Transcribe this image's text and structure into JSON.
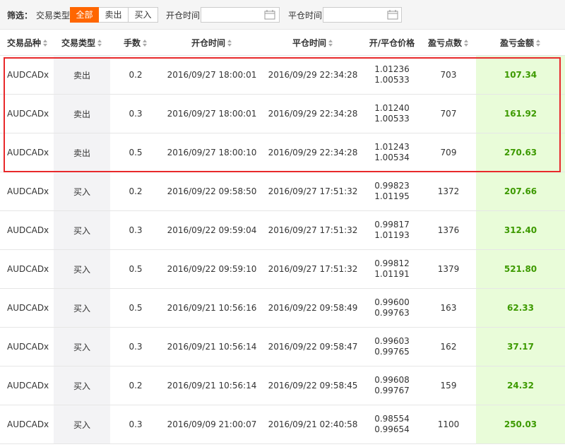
{
  "filter": {
    "label": "筛选：",
    "type_label": "交易类型",
    "buttons": [
      "全部",
      "卖出",
      "买入"
    ],
    "active": "全部",
    "open_time_label": "开仓时间",
    "open_time_value": "",
    "close_time_label": "平仓时间",
    "close_time_value": ""
  },
  "table": {
    "headers": [
      "交易品种",
      "交易类型",
      "手数",
      "开仓时间",
      "平仓时间",
      "开/平仓价格",
      "盈亏点数",
      "盈亏金额"
    ],
    "rows": [
      {
        "symbol": "AUDCADx",
        "type": "卖出",
        "lots": "0.2",
        "open_time": "2016/09/27 18:00:01",
        "close_time": "2016/09/29 22:34:28",
        "open_price": "1.01236",
        "close_price": "1.00533",
        "points": "703",
        "amount": "107.34"
      },
      {
        "symbol": "AUDCADx",
        "type": "卖出",
        "lots": "0.3",
        "open_time": "2016/09/27 18:00:01",
        "close_time": "2016/09/29 22:34:28",
        "open_price": "1.01240",
        "close_price": "1.00533",
        "points": "707",
        "amount": "161.92"
      },
      {
        "symbol": "AUDCADx",
        "type": "卖出",
        "lots": "0.5",
        "open_time": "2016/09/27 18:00:10",
        "close_time": "2016/09/29 22:34:28",
        "open_price": "1.01243",
        "close_price": "1.00534",
        "points": "709",
        "amount": "270.63"
      },
      {
        "symbol": "AUDCADx",
        "type": "买入",
        "lots": "0.2",
        "open_time": "2016/09/22 09:58:50",
        "close_time": "2016/09/27 17:51:32",
        "open_price": "0.99823",
        "close_price": "1.01195",
        "points": "1372",
        "amount": "207.66"
      },
      {
        "symbol": "AUDCADx",
        "type": "买入",
        "lots": "0.3",
        "open_time": "2016/09/22 09:59:04",
        "close_time": "2016/09/27 17:51:32",
        "open_price": "0.99817",
        "close_price": "1.01193",
        "points": "1376",
        "amount": "312.40"
      },
      {
        "symbol": "AUDCADx",
        "type": "买入",
        "lots": "0.5",
        "open_time": "2016/09/22 09:59:10",
        "close_time": "2016/09/27 17:51:32",
        "open_price": "0.99812",
        "close_price": "1.01191",
        "points": "1379",
        "amount": "521.80"
      },
      {
        "symbol": "AUDCADx",
        "type": "买入",
        "lots": "0.5",
        "open_time": "2016/09/21 10:56:16",
        "close_time": "2016/09/22 09:58:49",
        "open_price": "0.99600",
        "close_price": "0.99763",
        "points": "163",
        "amount": "62.33"
      },
      {
        "symbol": "AUDCADx",
        "type": "买入",
        "lots": "0.3",
        "open_time": "2016/09/21 10:56:14",
        "close_time": "2016/09/22 09:58:47",
        "open_price": "0.99603",
        "close_price": "0.99765",
        "points": "162",
        "amount": "37.17"
      },
      {
        "symbol": "AUDCADx",
        "type": "买入",
        "lots": "0.2",
        "open_time": "2016/09/21 10:56:14",
        "close_time": "2016/09/22 09:58:45",
        "open_price": "0.99608",
        "close_price": "0.99767",
        "points": "159",
        "amount": "24.32"
      },
      {
        "symbol": "AUDCADx",
        "type": "买入",
        "lots": "0.3",
        "open_time": "2016/09/09 21:00:07",
        "close_time": "2016/09/21 02:40:58",
        "open_price": "0.98554",
        "close_price": "0.99654",
        "points": "1100",
        "amount": "250.03"
      }
    ]
  },
  "colors": {
    "accent": "#ff6600",
    "profit": "#3d9a00",
    "profit_bg": "#e9fcd9",
    "highlight": "#e8292b"
  }
}
